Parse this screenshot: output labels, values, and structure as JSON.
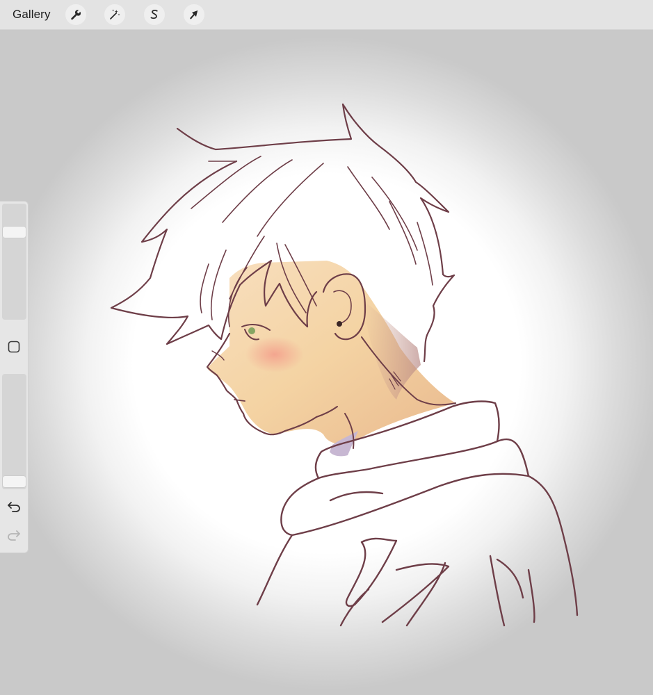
{
  "toolbar": {
    "gallery_label": "Gallery",
    "tools": [
      {
        "name": "actions",
        "icon": "wrench-icon"
      },
      {
        "name": "adjustments",
        "icon": "magic-wand-icon"
      },
      {
        "name": "selection",
        "icon": "selection-s-icon"
      },
      {
        "name": "transform",
        "icon": "arrow-cursor-icon"
      }
    ]
  },
  "sidebar": {
    "brush_size_level": 0.78,
    "opacity_level": 0.02,
    "modify_icon": "square-icon",
    "undo_icon": "undo-icon",
    "redo_icon": "redo-icon",
    "redo_enabled": false
  },
  "colors": {
    "line": "#6e3e48",
    "skin_light": "#fbe6c4",
    "skin_mid": "#f1c79a",
    "blush": "#f2a48f",
    "shadow": "#b99590",
    "eye": "#7aa05a",
    "canvas_bg": "#c9c9c9"
  }
}
